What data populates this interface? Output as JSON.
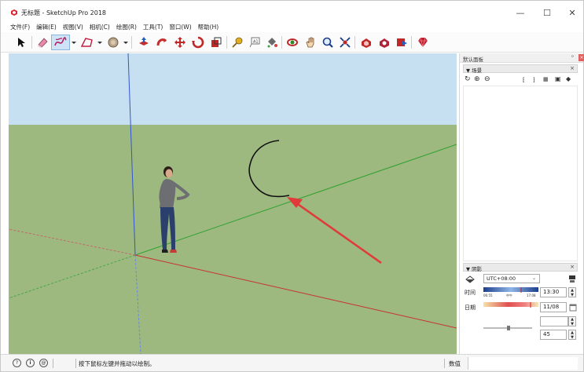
{
  "window": {
    "title": "无标题 - SketchUp Pro 2018",
    "controls": {
      "minimize": "—",
      "maximize": "☐",
      "close": "✕"
    }
  },
  "menu": [
    "文件(F)",
    "编辑(E)",
    "视图(V)",
    "相机(C)",
    "绘图(R)",
    "工具(T)",
    "窗口(W)",
    "帮助(H)"
  ],
  "toolbar": {
    "tools": [
      "select",
      "eraser",
      "freehand",
      "line",
      "paint",
      "push-pull",
      "follow-me",
      "move",
      "rotate",
      "scale",
      "tape-measure",
      "text",
      "paint-bucket",
      "orbit",
      "pan",
      "zoom",
      "zoom-extents",
      "warehouse",
      "extension-warehouse",
      "layout",
      "ruby"
    ],
    "active_tool": "freehand"
  },
  "tray": {
    "title": "默认面板",
    "pin": "ᵒ",
    "close": "×",
    "scenes": {
      "title": "▼ 场景",
      "close": "×",
      "icons": [
        "refresh-icon",
        "add-icon",
        "remove-icon",
        "move-up-icon",
        "move-down-icon",
        "view-options-icon",
        "details-icon",
        "expand-icon"
      ]
    },
    "shadows": {
      "title": "▼ 阴影",
      "close": "×",
      "timezone": "UTC+08:00",
      "time_label": "时间",
      "time_value": "13:30",
      "time_ticks": [
        "06:55",
        "中午",
        "17:08"
      ],
      "date_label": "日期",
      "date_value": "11/08",
      "light_value": "45"
    }
  },
  "status": {
    "hint": "按下鼠标左键并拖动以绘制。",
    "measure_label": "数值",
    "measure_value": ""
  },
  "colors": {
    "sky": "#c4def0",
    "ground": "#9cb87e",
    "axis_red": "#cc3333",
    "axis_green": "#33aa33",
    "axis_blue": "#3355cc",
    "arrow": "#e03a3a"
  }
}
